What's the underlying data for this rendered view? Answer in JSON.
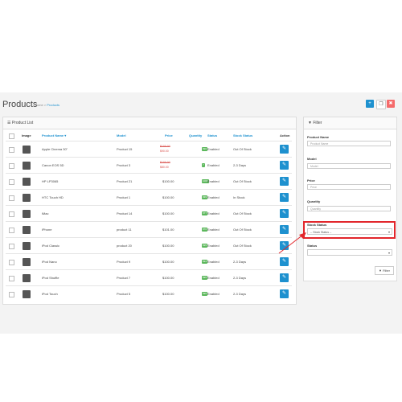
{
  "page": {
    "title": "Products",
    "breadcrumb_home": "Home",
    "breadcrumb_current": "Products"
  },
  "toolbar": {
    "add_icon": "plus-icon",
    "copy_icon": "copy-icon",
    "delete_icon": "trash-icon"
  },
  "list": {
    "heading": "Product List",
    "columns": {
      "image": "Image",
      "name": "Product Name",
      "model": "Model",
      "price": "Price",
      "quantity": "Quantity",
      "status": "Status",
      "stock_status": "Stock Status",
      "action": "Action"
    },
    "rows": [
      {
        "name": "Apple Cinema 30\"",
        "model": "Product 15",
        "price_old": "$100.00",
        "price": "$90.00",
        "quantity": "990",
        "status": "Enabled",
        "stock": "Out Of Stock"
      },
      {
        "name": "Canon EOS 5D",
        "model": "Product 3",
        "price_old": "$100.00",
        "price": "$80.00",
        "quantity": "7",
        "status": "Enabled",
        "stock": "2-3 Days"
      },
      {
        "name": "HP LP3065",
        "model": "Product 21",
        "price": "$100.00",
        "quantity": "1000",
        "status": "Enabled",
        "stock": "Out Of Stock"
      },
      {
        "name": "HTC Touch HD",
        "model": "Product 1",
        "price": "$100.00",
        "quantity": "939",
        "status": "Enabled",
        "stock": "In Stock"
      },
      {
        "name": "iMac",
        "model": "Product 14",
        "price": "$100.00",
        "quantity": "977",
        "status": "Enabled",
        "stock": "Out Of Stock"
      },
      {
        "name": "iPhone",
        "model": "product 11",
        "price": "$101.00",
        "quantity": "970",
        "status": "Enabled",
        "stock": "Out Of Stock"
      },
      {
        "name": "iPod Classic",
        "model": "product 20",
        "price": "$100.00",
        "quantity": "995",
        "status": "Enabled",
        "stock": "Out Of Stock"
      },
      {
        "name": "iPod Nano",
        "model": "Product 9",
        "price": "$100.00",
        "quantity": "994",
        "status": "Enabled",
        "stock": "2-3 Days"
      },
      {
        "name": "iPod Shuffle",
        "model": "Product 7",
        "price": "$100.00",
        "quantity": "995",
        "status": "Enabled",
        "stock": "2-3 Days"
      },
      {
        "name": "iPod Touch",
        "model": "Product 5",
        "price": "$100.00",
        "quantity": "995",
        "status": "Enabled",
        "stock": "2-3 Days"
      }
    ]
  },
  "filter": {
    "heading": "Filter",
    "product_name_label": "Product Name",
    "product_name_placeholder": "Product Name",
    "model_label": "Model",
    "model_placeholder": "Model",
    "price_label": "Price",
    "price_placeholder": "Price",
    "quantity_label": "Quantity",
    "quantity_placeholder": "Quantity",
    "stock_status_label": "Stock Status",
    "stock_status_value": "-- Stock Status --",
    "status_label": "Status",
    "status_value": "",
    "button_label": "Filter"
  },
  "colors": {
    "accent": "#1e91cf",
    "danger": "#f56b6b",
    "success": "#5cb85c",
    "highlight": "#e2262b"
  }
}
